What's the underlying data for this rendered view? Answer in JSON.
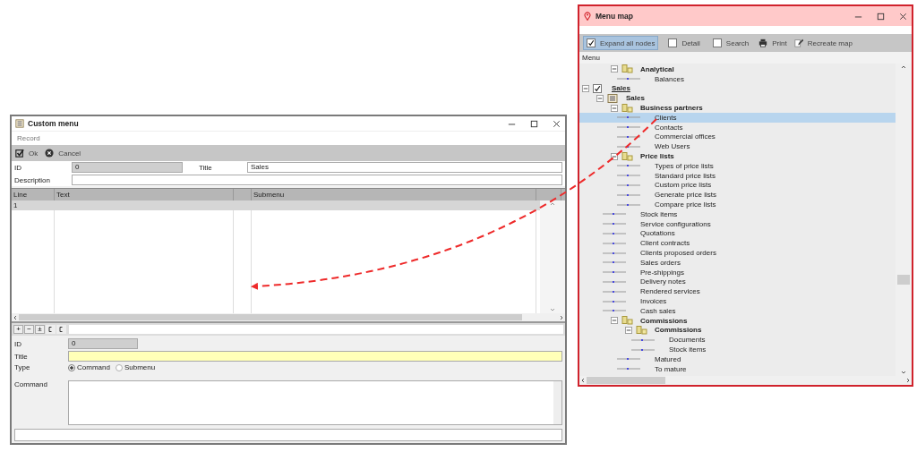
{
  "custom_menu": {
    "title": "Custom menu",
    "menu": [
      "Record"
    ],
    "toolbar": [
      {
        "label": "Ok",
        "kind": "ok"
      },
      {
        "label": "Cancel",
        "kind": "cancel"
      }
    ],
    "id": {
      "label": "ID",
      "value": "0"
    },
    "title_field": {
      "label": "Title",
      "value": "Sales"
    },
    "description": {
      "label": "Description"
    },
    "table": {
      "columns": [
        "Line",
        "Text",
        "",
        "Submenu",
        ""
      ],
      "rows": [
        {
          "line": "1",
          "selected": true
        }
      ]
    },
    "row_tools": [
      {
        "kind": "text",
        "label": "+"
      },
      {
        "kind": "text",
        "label": "−"
      },
      {
        "kind": "text",
        "label": "±"
      },
      {
        "kind": "icon"
      },
      {
        "kind": "icon"
      }
    ],
    "detail": {
      "id": {
        "label": "ID",
        "value": "0"
      },
      "title": {
        "label": "Title"
      },
      "type": {
        "label": "Type",
        "options": [
          {
            "label": "Command",
            "selected": true
          },
          {
            "label": "Submenu",
            "selected": false
          }
        ]
      },
      "command": {
        "label": "Command"
      }
    }
  },
  "menu_map": {
    "title": "Menu map",
    "toolbar": [
      {
        "kind": "check",
        "label": "Expand all nodes",
        "checked": true
      },
      {
        "kind": "check",
        "label": "Detail",
        "checked": false
      },
      {
        "kind": "check",
        "label": "Search",
        "checked": false
      },
      {
        "kind": "print",
        "label": "Print"
      },
      {
        "kind": "recreate",
        "label": "Recreate map"
      }
    ],
    "column": "Menu",
    "tree_partial": [
      {
        "label": "Analytical",
        "kind": "folder",
        "expanded": true,
        "selected": false,
        "children": [
          {
            "label": "Balances",
            "kind": "leaf",
            "selected": false
          }
        ]
      }
    ],
    "tree": [
      {
        "label": "Sales",
        "kind": "root",
        "checked": true,
        "expanded": true,
        "selected": false,
        "children": [
          {
            "label": "Sales",
            "kind": "module",
            "expanded": true,
            "selected": false,
            "children": [
              {
                "label": "Business partners",
                "kind": "folder",
                "expanded": true,
                "selected": false,
                "children": [
                  {
                    "label": "Clients",
                    "kind": "leaf",
                    "selected": true
                  },
                  {
                    "label": "Contacts",
                    "kind": "leaf",
                    "selected": false
                  },
                  {
                    "label": "Commercial offices",
                    "kind": "leaf",
                    "selected": false
                  },
                  {
                    "label": "Web Users",
                    "kind": "leaf",
                    "selected": false
                  }
                ]
              },
              {
                "label": "Price lists",
                "kind": "folder",
                "expanded": true,
                "selected": false,
                "children": [
                  {
                    "label": "Types of price lists",
                    "kind": "leaf",
                    "selected": false
                  },
                  {
                    "label": "Standard price lists",
                    "kind": "leaf",
                    "selected": false
                  },
                  {
                    "label": "Custom price lists",
                    "kind": "leaf",
                    "selected": false
                  },
                  {
                    "label": "Generate price lists",
                    "kind": "leaf",
                    "selected": false
                  },
                  {
                    "label": "Compare price lists",
                    "kind": "leaf",
                    "selected": false
                  }
                ]
              },
              {
                "label": "Stock items",
                "kind": "leaf",
                "selected": false
              },
              {
                "label": "Service configurations",
                "kind": "leaf",
                "selected": false
              },
              {
                "label": "Quotations",
                "kind": "leaf",
                "selected": false
              },
              {
                "label": "Client contracts",
                "kind": "leaf",
                "selected": false
              },
              {
                "label": "Clients proposed orders",
                "kind": "leaf",
                "selected": false
              },
              {
                "label": "Sales orders",
                "kind": "leaf",
                "selected": false
              },
              {
                "label": "Pre-shippings",
                "kind": "leaf",
                "selected": false
              },
              {
                "label": "Delivery notes",
                "kind": "leaf",
                "selected": false
              },
              {
                "label": "Rendered services",
                "kind": "leaf",
                "selected": false
              },
              {
                "label": "Invoices",
                "kind": "leaf",
                "selected": false
              },
              {
                "label": "Cash sales",
                "kind": "leaf",
                "selected": false
              },
              {
                "label": "Commissions",
                "kind": "folder",
                "expanded": true,
                "selected": false,
                "children": [
                  {
                    "label": "Commissions",
                    "kind": "folder",
                    "expanded": true,
                    "selected": false,
                    "children": [
                      {
                        "label": "Documents",
                        "kind": "leaf",
                        "selected": false
                      },
                      {
                        "label": "Stock items",
                        "kind": "leaf",
                        "selected": false
                      }
                    ]
                  },
                  {
                    "label": "Matured",
                    "kind": "leaf",
                    "selected": false
                  },
                  {
                    "label": "To mature",
                    "kind": "leaf",
                    "selected": false
                  }
                ]
              }
            ]
          }
        ]
      }
    ]
  }
}
